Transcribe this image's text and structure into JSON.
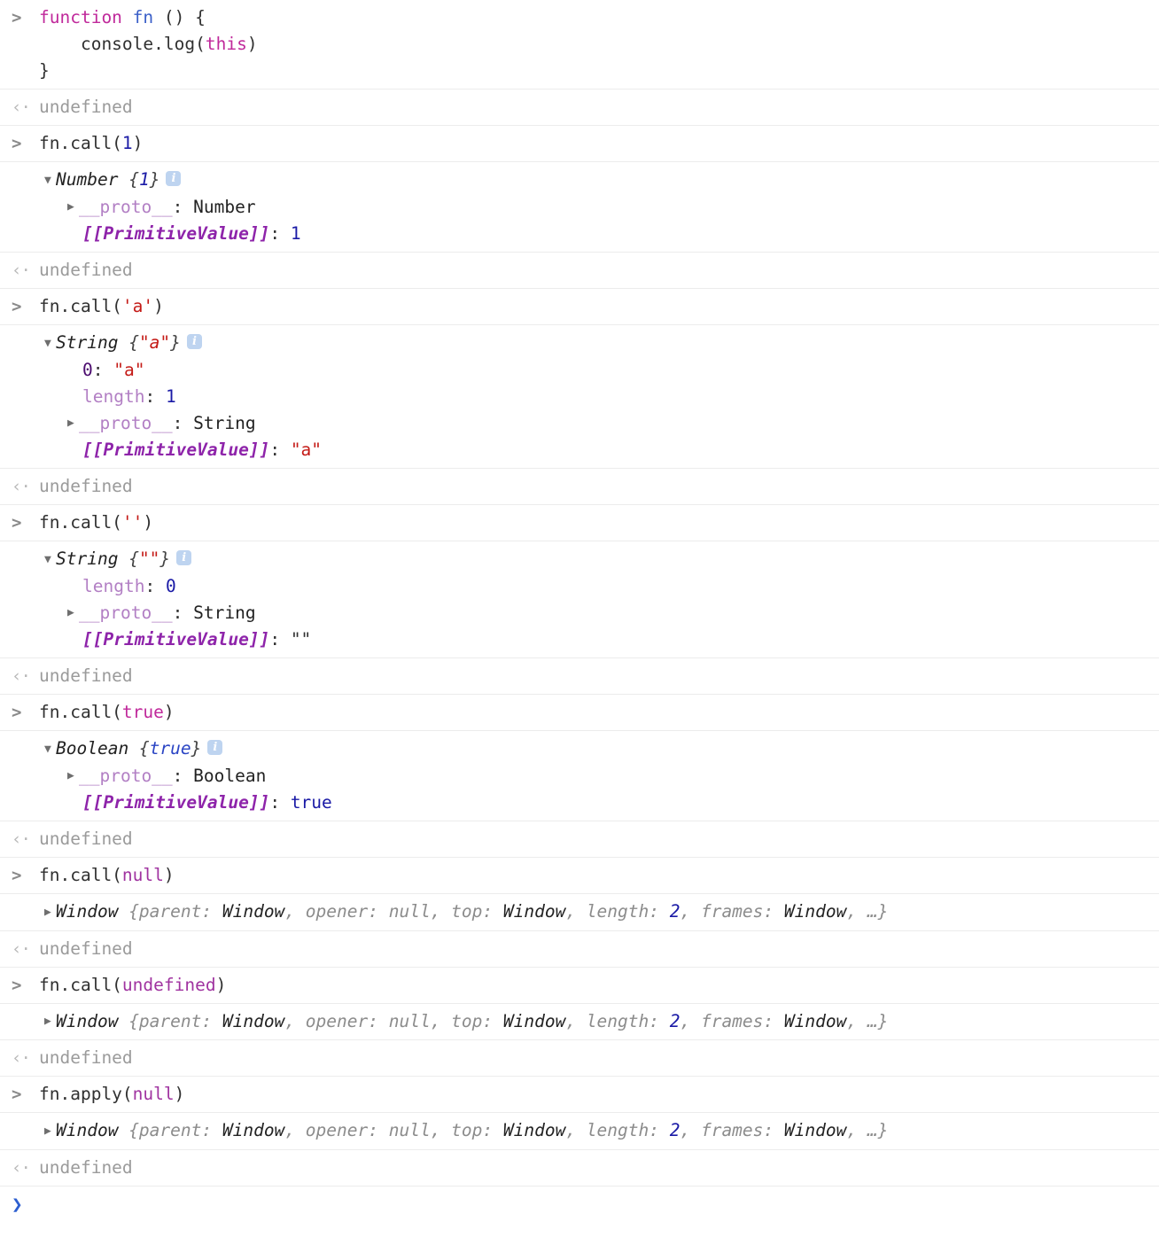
{
  "console": {
    "gutter": {
      "input_glyph": ">",
      "output_glyph": "‹·",
      "prompt_glyph": "❯",
      "expand_open": "▼",
      "expand_closed": "▶"
    },
    "info_icon_label": "i",
    "undefined_label": "undefined",
    "entries": [
      {
        "kind": "input",
        "lines": [
          {
            "tokens": [
              {
                "t": "function",
                "c": "kw"
              },
              {
                "t": " ",
                "c": "plain"
              },
              {
                "t": "fn",
                "c": "fname"
              },
              {
                "t": " () {",
                "c": "plain"
              }
            ]
          },
          {
            "tokens": [
              {
                "t": "    console.log(",
                "c": "plain"
              },
              {
                "t": "this",
                "c": "this"
              },
              {
                "t": ")",
                "c": "plain"
              }
            ]
          },
          {
            "tokens": [
              {
                "t": "}",
                "c": "plain"
              }
            ]
          }
        ]
      },
      {
        "kind": "output-undefined",
        "text": "undefined"
      },
      {
        "kind": "input",
        "lines": [
          {
            "tokens": [
              {
                "t": "fn.call(",
                "c": "plain"
              },
              {
                "t": "1",
                "c": "num"
              },
              {
                "t": ")",
                "c": "plain"
              }
            ]
          }
        ]
      },
      {
        "kind": "object",
        "header": {
          "ctor": "Number",
          "open": "{",
          "value": "1",
          "value_class": "objnum",
          "close": "}",
          "expanded": true,
          "info": true
        },
        "props": [
          {
            "indent": 2,
            "arrow": "closed",
            "key": "__proto__",
            "key_class": "key-proto",
            "sep": ": ",
            "value": "Number",
            "value_class": "val-black"
          },
          {
            "indent": 3,
            "arrow": "none",
            "key": "[[PrimitiveValue]]",
            "key_class": "key-internal",
            "sep": ": ",
            "value": "1",
            "value_class": "val-blue"
          }
        ]
      },
      {
        "kind": "output-undefined",
        "text": "undefined"
      },
      {
        "kind": "input",
        "lines": [
          {
            "tokens": [
              {
                "t": "fn.call(",
                "c": "plain"
              },
              {
                "t": "'a'",
                "c": "str"
              },
              {
                "t": ")",
                "c": "plain"
              }
            ]
          }
        ]
      },
      {
        "kind": "object",
        "header": {
          "ctor": "String",
          "open": "{",
          "value": "\"a\"",
          "value_class": "objstr",
          "close": "}",
          "expanded": true,
          "info": true
        },
        "props": [
          {
            "indent": 3,
            "arrow": "none",
            "key": "0",
            "key_class": "key-dark",
            "sep": ": ",
            "value": "\"a\"",
            "value_class": "str"
          },
          {
            "indent": 3,
            "arrow": "none",
            "key": "length",
            "key_class": "key-light",
            "sep": ": ",
            "value": "1",
            "value_class": "val-blue"
          },
          {
            "indent": 2,
            "arrow": "closed",
            "key": "__proto__",
            "key_class": "key-proto",
            "sep": ": ",
            "value": "String",
            "value_class": "val-black"
          },
          {
            "indent": 3,
            "arrow": "none",
            "key": "[[PrimitiveValue]]",
            "key_class": "key-internal",
            "sep": ": ",
            "value": "\"a\"",
            "value_class": "str"
          }
        ]
      },
      {
        "kind": "output-undefined",
        "text": "undefined"
      },
      {
        "kind": "input",
        "lines": [
          {
            "tokens": [
              {
                "t": "fn.call(",
                "c": "plain"
              },
              {
                "t": "''",
                "c": "str"
              },
              {
                "t": ")",
                "c": "plain"
              }
            ]
          }
        ]
      },
      {
        "kind": "object",
        "header": {
          "ctor": "String",
          "open": "{",
          "value": "\"\"",
          "value_class": "objstr",
          "close": "}",
          "expanded": true,
          "info": true
        },
        "props": [
          {
            "indent": 3,
            "arrow": "none",
            "key": "length",
            "key_class": "key-light",
            "sep": ": ",
            "value": "0",
            "value_class": "val-blue"
          },
          {
            "indent": 2,
            "arrow": "closed",
            "key": "__proto__",
            "key_class": "key-proto",
            "sep": ": ",
            "value": "String",
            "value_class": "val-black"
          },
          {
            "indent": 3,
            "arrow": "none",
            "key": "[[PrimitiveValue]]",
            "key_class": "key-internal",
            "sep": ": ",
            "value": "\"\"",
            "value_class": "quote"
          }
        ]
      },
      {
        "kind": "output-undefined",
        "text": "undefined"
      },
      {
        "kind": "input",
        "lines": [
          {
            "tokens": [
              {
                "t": "fn.call(",
                "c": "plain"
              },
              {
                "t": "true",
                "c": "bool"
              },
              {
                "t": ")",
                "c": "plain"
              }
            ]
          }
        ]
      },
      {
        "kind": "object",
        "header": {
          "ctor": "Boolean",
          "open": "{",
          "value": "true",
          "value_class": "objbool",
          "close": "}",
          "expanded": true,
          "info": true
        },
        "props": [
          {
            "indent": 2,
            "arrow": "closed",
            "key": "__proto__",
            "key_class": "key-proto",
            "sep": ": ",
            "value": "Boolean",
            "value_class": "val-black"
          },
          {
            "indent": 3,
            "arrow": "none",
            "key": "[[PrimitiveValue]]",
            "key_class": "key-internal",
            "sep": ": ",
            "value": "true",
            "value_class": "val-blue"
          }
        ]
      },
      {
        "kind": "output-undefined",
        "text": "undefined"
      },
      {
        "kind": "input",
        "lines": [
          {
            "tokens": [
              {
                "t": "fn.call(",
                "c": "plain"
              },
              {
                "t": "null",
                "c": "nullv"
              },
              {
                "t": ")",
                "c": "plain"
              }
            ]
          }
        ]
      },
      {
        "kind": "window",
        "ctor": "Window",
        "preview_parts": [
          {
            "t": "{parent: ",
            "c": "prop-gray"
          },
          {
            "t": "Window",
            "c": "prop-obj"
          },
          {
            "t": ", opener: ",
            "c": "prop-gray"
          },
          {
            "t": "null",
            "c": "prop-gray"
          },
          {
            "t": ", top: ",
            "c": "prop-gray"
          },
          {
            "t": "Window",
            "c": "prop-obj"
          },
          {
            "t": ", length: ",
            "c": "prop-gray"
          },
          {
            "t": "2",
            "c": "objnum"
          },
          {
            "t": ", frames: ",
            "c": "prop-gray"
          },
          {
            "t": "Window",
            "c": "prop-obj"
          },
          {
            "t": ", …}",
            "c": "prop-gray"
          }
        ]
      },
      {
        "kind": "output-undefined",
        "text": "undefined"
      },
      {
        "kind": "input",
        "lines": [
          {
            "tokens": [
              {
                "t": "fn.call(",
                "c": "plain"
              },
              {
                "t": "undefined",
                "c": "nullv"
              },
              {
                "t": ")",
                "c": "plain"
              }
            ]
          }
        ]
      },
      {
        "kind": "window",
        "ctor": "Window",
        "preview_parts": [
          {
            "t": "{parent: ",
            "c": "prop-gray"
          },
          {
            "t": "Window",
            "c": "prop-obj"
          },
          {
            "t": ", opener: ",
            "c": "prop-gray"
          },
          {
            "t": "null",
            "c": "prop-gray"
          },
          {
            "t": ", top: ",
            "c": "prop-gray"
          },
          {
            "t": "Window",
            "c": "prop-obj"
          },
          {
            "t": ", length: ",
            "c": "prop-gray"
          },
          {
            "t": "2",
            "c": "objnum"
          },
          {
            "t": ", frames: ",
            "c": "prop-gray"
          },
          {
            "t": "Window",
            "c": "prop-obj"
          },
          {
            "t": ", …}",
            "c": "prop-gray"
          }
        ]
      },
      {
        "kind": "output-undefined",
        "text": "undefined"
      },
      {
        "kind": "input",
        "lines": [
          {
            "tokens": [
              {
                "t": "fn.apply(",
                "c": "plain"
              },
              {
                "t": "null",
                "c": "nullv"
              },
              {
                "t": ")",
                "c": "plain"
              }
            ]
          }
        ]
      },
      {
        "kind": "window",
        "ctor": "Window",
        "preview_parts": [
          {
            "t": "{parent: ",
            "c": "prop-gray"
          },
          {
            "t": "Window",
            "c": "prop-obj"
          },
          {
            "t": ", opener: ",
            "c": "prop-gray"
          },
          {
            "t": "null",
            "c": "prop-gray"
          },
          {
            "t": ", top: ",
            "c": "prop-gray"
          },
          {
            "t": "Window",
            "c": "prop-obj"
          },
          {
            "t": ", length: ",
            "c": "prop-gray"
          },
          {
            "t": "2",
            "c": "objnum"
          },
          {
            "t": ", frames: ",
            "c": "prop-gray"
          },
          {
            "t": "Window",
            "c": "prop-obj"
          },
          {
            "t": ", …}",
            "c": "prop-gray"
          }
        ]
      },
      {
        "kind": "output-undefined",
        "text": "undefined"
      },
      {
        "kind": "prompt"
      }
    ]
  },
  "colors": {
    "background": "#ffffff",
    "divider": "#ececec",
    "keyword": "#c0299b",
    "function_name": "#3a5fc8",
    "number": "#1a1aa6",
    "string": "#c41a16",
    "undefined_gray": "#9b9b9b",
    "proto_key": "#b27fc4",
    "internal_key": "#8e24aa",
    "info_icon_bg": "#bed4f0",
    "prompt_blue": "#2d5fd0"
  }
}
